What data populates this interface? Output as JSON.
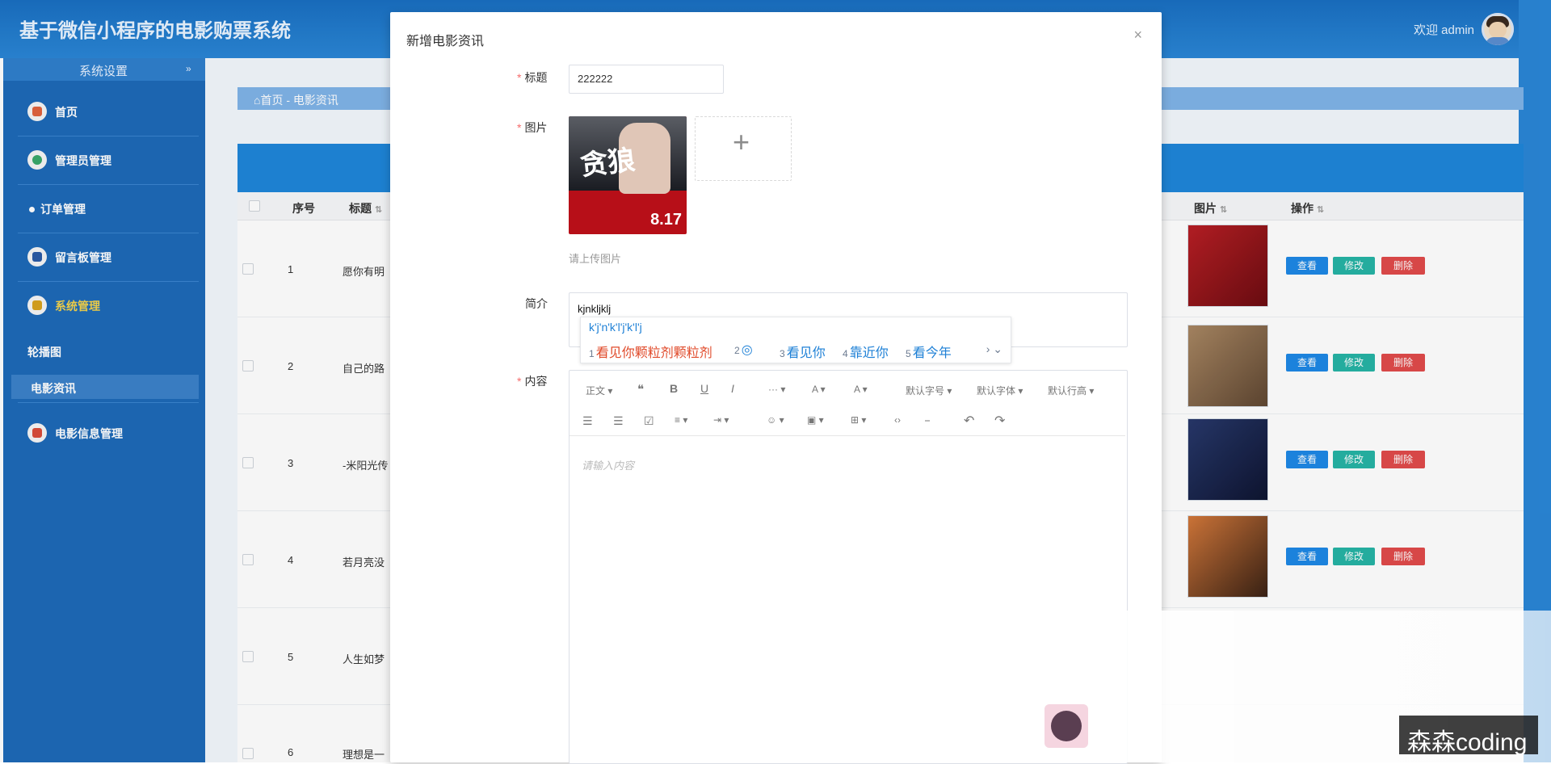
{
  "header": {
    "app_title": "基于微信小程序的电影购票系统",
    "welcome": "欢迎 admin"
  },
  "sidebar": {
    "system_settings": "系统设置",
    "chevron": "»",
    "items": [
      {
        "label": "首页",
        "icon": "home-icon",
        "color": "#e0623d"
      },
      {
        "label": "管理员管理",
        "icon": "user-icon",
        "color": "#3aa86b"
      },
      {
        "label": "订单管理",
        "icon": "dot-icon",
        "color": "#ffffff"
      },
      {
        "label": "留言板管理",
        "icon": "board-icon",
        "color": "#2b5ba6"
      },
      {
        "label": "系统管理",
        "icon": "grid-icon",
        "color": "#d8a21e"
      }
    ],
    "sub_items": [
      {
        "label": "轮播图"
      },
      {
        "label": "电影资讯"
      }
    ],
    "movie_item": {
      "label": "电影信息管理",
      "icon": "movie-icon",
      "color": "#d94c3a"
    }
  },
  "breadcrumb": {
    "text": "⌂首页 - 电影资讯"
  },
  "table": {
    "headers": {
      "index": "序号",
      "title": "标题",
      "image": "图片",
      "actions": "操作"
    },
    "sort_icon": "⇅",
    "rows": [
      {
        "index": "1",
        "title": "愿你有明"
      },
      {
        "index": "2",
        "title": "自己的路"
      },
      {
        "index": "3",
        "title": "-米阳光传"
      },
      {
        "index": "4",
        "title": "若月亮没"
      },
      {
        "index": "5",
        "title": "人生如梦"
      },
      {
        "index": "6",
        "title": "理想是一"
      }
    ],
    "buttons": {
      "view": "查看",
      "edit": "修改",
      "delete": "删除",
      "view_color": "#1e88e5",
      "edit_color": "#26b3a5",
      "delete_color": "#e04a4a"
    }
  },
  "modal": {
    "title": "新增电影资讯",
    "close": "×",
    "fields": {
      "title_label": "标题",
      "title_value": "222222",
      "image_label": "图片",
      "upload_hint": "请上传图片",
      "upload_plus": "+",
      "intro_label": "简介",
      "intro_value": "kjnkljklj",
      "content_label": "内容",
      "content_placeholder": "请输入内容"
    },
    "poster": {
      "glyph": "贪狼",
      "year": "8.17"
    },
    "ime": {
      "pinyin": "k'j'n'k'l'j'k'l'j",
      "candidates": [
        {
          "n": "1",
          "text": "看见你颗粒剂颗粒剂",
          "color": "#e04a2a"
        },
        {
          "n": "2",
          "text": "◎",
          "color": "#1e80d6"
        },
        {
          "n": "3",
          "text": "看见你",
          "color": "#1e80d6"
        },
        {
          "n": "4",
          "text": "靠近你",
          "color": "#1e80d6"
        },
        {
          "n": "5",
          "text": "看今年",
          "color": "#1e80d6"
        }
      ],
      "more": "› ⌄"
    },
    "toolbar": {
      "row1": [
        "正文 ▾",
        "❝",
        "B",
        "U",
        "I",
        "··· ▾",
        "A ▾",
        "A ▾",
        "默认字号 ▾",
        "默认字体 ▾",
        "默认行高 ▾"
      ],
      "row2": [
        "☰",
        "☰",
        "☑",
        "≡ ▾",
        "⇥ ▾",
        "☺ ▾",
        "▣ ▾",
        "⊞ ▾",
        "‹›",
        "⎯",
        "↶",
        "↷"
      ]
    }
  },
  "watermark": "森森coding"
}
